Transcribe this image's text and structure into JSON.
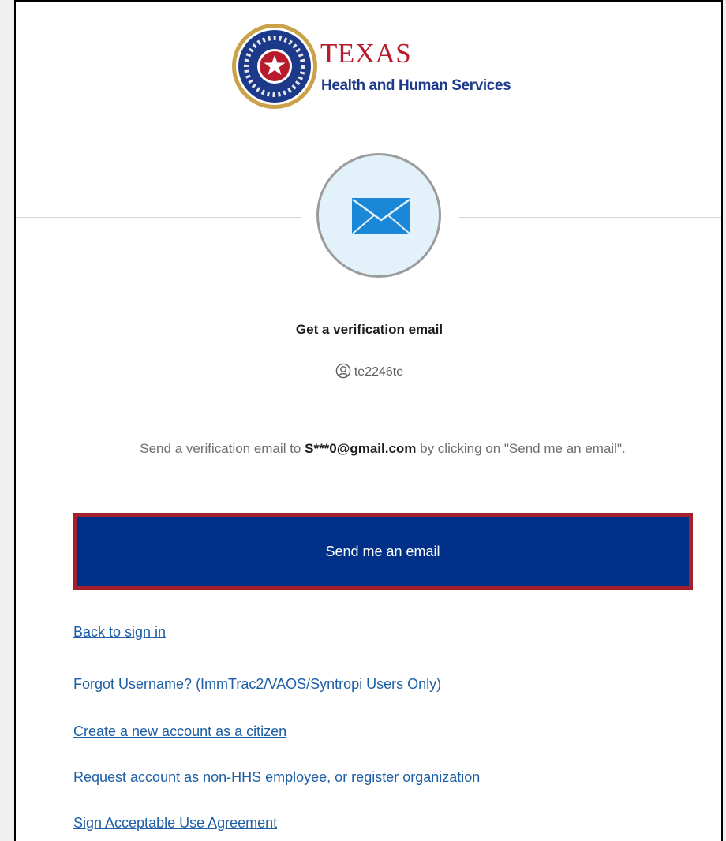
{
  "logo": {
    "title": "TEXAS",
    "subtitle": "Health and Human Services"
  },
  "icons": {
    "seal": "texas-seal-icon",
    "mail": "envelope-icon",
    "user": "user-circle-icon"
  },
  "heading": "Get a verification email",
  "username": "te2246te",
  "message": {
    "before": "Send a verification email to ",
    "email": "S***0@gmail.com",
    "after": " by clicking on \"Send me an email\"."
  },
  "send_button": "Send me an email",
  "links": {
    "back": "Back to sign in",
    "forgot": "Forgot Username? (ImmTrac2/VAOS/Syntropi Users Only)",
    "create": "Create a new account as a citizen",
    "request": "Request account as non-HHS employee, or register organization",
    "sign": "Sign Acceptable Use Agreement"
  },
  "colors": {
    "button_bg": "#013088",
    "button_border": "#a5202f",
    "link": "#1d5fa6",
    "brand_red": "#b81c2c",
    "brand_blue": "#1d3a8a",
    "mail_circle_bg": "#e3f1fb"
  }
}
